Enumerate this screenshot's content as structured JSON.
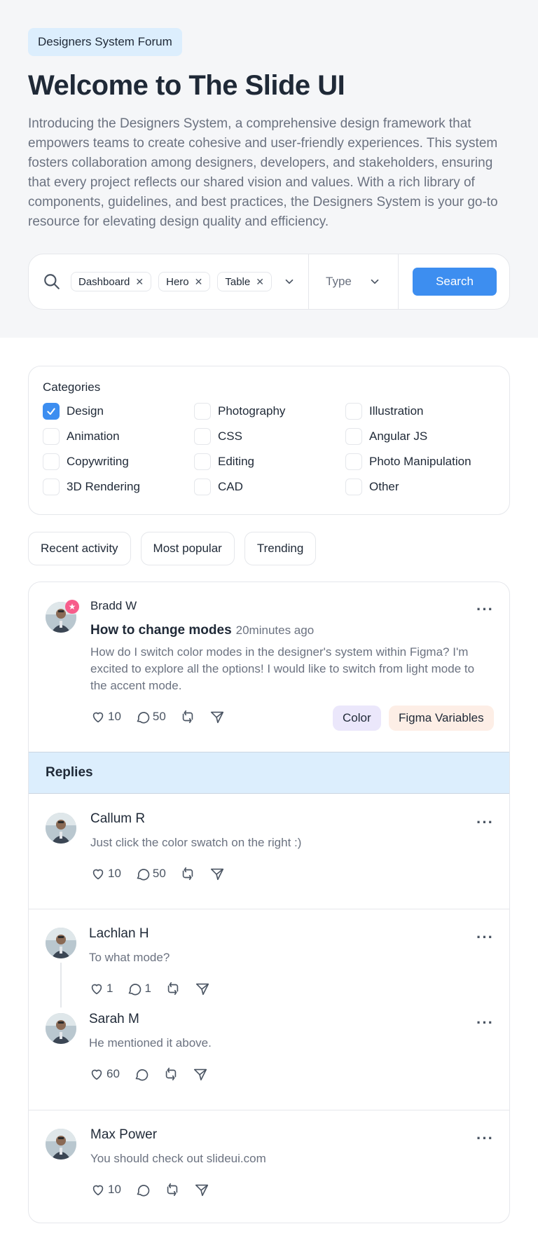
{
  "hero": {
    "badge": "Designers System Forum",
    "title": "Welcome to The Slide UI",
    "intro": "Introducing the Designers System, a comprehensive design framework that empowers teams to create cohesive and user-friendly experiences. This system fosters collaboration among designers, developers, and stakeholders, ensuring that every project reflects our shared vision and values. With a rich library of components, guidelines, and best practices, the Designers System is your go-to resource for elevating design quality and efficiency."
  },
  "search": {
    "chips": [
      "Dashboard",
      "Hero",
      "Table"
    ],
    "type_placeholder": "Type",
    "button_label": "Search"
  },
  "categories": {
    "title": "Categories",
    "items": [
      {
        "label": "Design",
        "checked": true
      },
      {
        "label": "Photography",
        "checked": false
      },
      {
        "label": "Illustration",
        "checked": false
      },
      {
        "label": "Animation",
        "checked": false
      },
      {
        "label": "CSS",
        "checked": false
      },
      {
        "label": "Angular JS",
        "checked": false
      },
      {
        "label": "Copywriting",
        "checked": false
      },
      {
        "label": "Editing",
        "checked": false
      },
      {
        "label": "Photo Manipulation",
        "checked": false
      },
      {
        "label": "3D Rendering",
        "checked": false
      },
      {
        "label": "CAD",
        "checked": false
      },
      {
        "label": "Other",
        "checked": false
      }
    ]
  },
  "filters": [
    "Recent activity",
    "Most popular",
    "Trending"
  ],
  "post": {
    "author": "Bradd W",
    "title": "How to change modes",
    "time": "20minutes ago",
    "body": "How do I switch color modes in the designer's system within Figma? I'm excited to explore all the options! I would like to switch from light mode to the accent mode.",
    "likes": "10",
    "comments": "50",
    "tags": [
      "Color",
      "Figma Variables"
    ]
  },
  "replies_label": "Replies",
  "replies": [
    {
      "author": "Callum R",
      "text": "Just click the color swatch on the right :)",
      "likes": "10",
      "comments": "50"
    },
    {
      "author": "Lachlan H",
      "text": "To what mode?",
      "likes": "1",
      "comments": "1"
    },
    {
      "author": "Sarah M",
      "text": "He mentioned it above.",
      "likes": "60",
      "comments": ""
    },
    {
      "author": "Max Power",
      "text": "You should check out slideui.com",
      "likes": "10",
      "comments": ""
    }
  ],
  "colors": {
    "accent": "#3d8ef0",
    "badge_bg": "#dceefd",
    "tag_color_bg": "#ebe7fb",
    "tag_figma_bg": "#fdeee6",
    "star_badge": "#f75d8b"
  }
}
